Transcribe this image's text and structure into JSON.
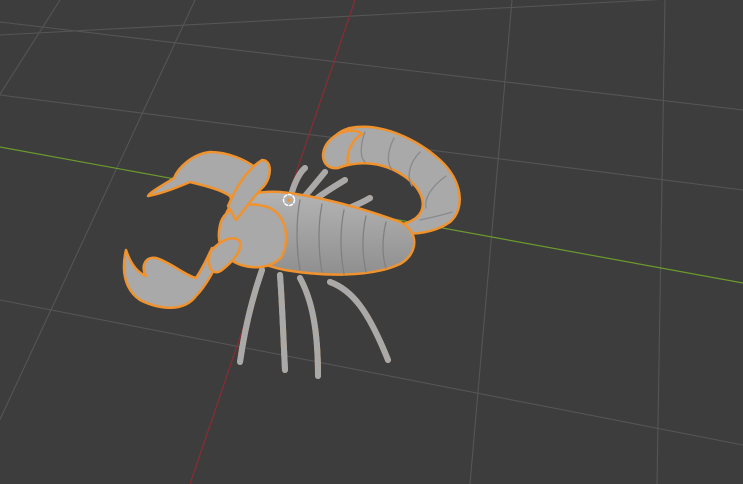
{
  "viewport": {
    "view": "3D Viewport",
    "background_color": "#3d3d3d",
    "grid_color": "#555555",
    "x_axis_color": "#8a2c33",
    "y_axis_color": "#6b9a2d",
    "selection_outline_color": "#f0932e",
    "mesh_color": "#a9a9a9"
  },
  "scene": {
    "object": "scorpion-mesh",
    "selected": true,
    "origin_shown": true
  }
}
